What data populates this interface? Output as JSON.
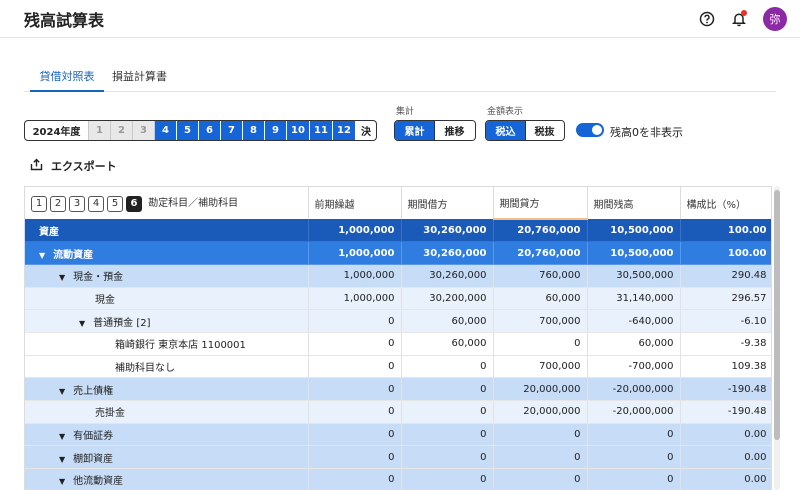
{
  "header": {
    "title": "残高試算表",
    "icons": [
      "help-icon",
      "bell-icon"
    ],
    "avatar_text": "弥"
  },
  "tabs": [
    {
      "label": "貸借対照表",
      "active": true
    },
    {
      "label": "損益計算書",
      "active": false
    }
  ],
  "period": {
    "year": "2024年度",
    "disabled_months": [
      "1",
      "2",
      "3"
    ],
    "active_months": [
      "4",
      "5",
      "6",
      "7",
      "8",
      "9",
      "10",
      "11",
      "12"
    ],
    "closing": "決"
  },
  "aggregation": {
    "label": "集計",
    "options": [
      "累計",
      "推移"
    ],
    "selected": "累計"
  },
  "amount_display": {
    "label": "金額表示",
    "options": [
      "税込",
      "税抜"
    ],
    "selected": "税込"
  },
  "hide_zero": {
    "label": "残高0を非表示",
    "on": true
  },
  "export_label": "エクスポート",
  "table": {
    "level_buttons": [
      "1",
      "2",
      "3",
      "4",
      "5",
      "6"
    ],
    "active_level": "6",
    "account_header": "勘定科目／補助科目",
    "columns": [
      "前期繰越",
      "期間借方",
      "期間貸方",
      "期間残高",
      "構成比（%）"
    ],
    "rows": [
      {
        "name": "資産",
        "level": 0,
        "caret": false,
        "values": [
          "1,000,000",
          "30,260,000",
          "20,760,000",
          "10,500,000",
          "100.00"
        ]
      },
      {
        "name": "流動資産",
        "level": 1,
        "caret": true,
        "values": [
          "1,000,000",
          "30,260,000",
          "20,760,000",
          "10,500,000",
          "100.00"
        ]
      },
      {
        "name": "現金・預金",
        "level": 2,
        "caret": true,
        "values": [
          "1,000,000",
          "30,260,000",
          "760,000",
          "30,500,000",
          "290.48"
        ]
      },
      {
        "name": "現金",
        "level": 3,
        "caret": false,
        "values": [
          "1,000,000",
          "30,200,000",
          "60,000",
          "31,140,000",
          "296.57"
        ]
      },
      {
        "name": "普通預金 [2]",
        "level": 3,
        "caret": true,
        "values": [
          "0",
          "60,000",
          "700,000",
          "-640,000",
          "-6.10"
        ]
      },
      {
        "name": "箱崎銀行 東京本店 1100001",
        "level": 4,
        "caret": false,
        "values": [
          "0",
          "60,000",
          "0",
          "60,000",
          "-9.38"
        ]
      },
      {
        "name": "補助科目なし",
        "level": 4,
        "caret": false,
        "values": [
          "0",
          "0",
          "700,000",
          "-700,000",
          "109.38"
        ]
      },
      {
        "name": "売上債権",
        "level": 2,
        "caret": true,
        "values": [
          "0",
          "0",
          "20,000,000",
          "-20,000,000",
          "-190.48"
        ]
      },
      {
        "name": "売掛金",
        "level": 3,
        "caret": false,
        "values": [
          "0",
          "0",
          "20,000,000",
          "-20,000,000",
          "-190.48"
        ]
      },
      {
        "name": "有価証券",
        "level": 2,
        "caret": true,
        "values": [
          "0",
          "0",
          "0",
          "0",
          "0.00"
        ]
      },
      {
        "name": "棚卸資産",
        "level": 2,
        "caret": true,
        "values": [
          "0",
          "0",
          "0",
          "0",
          "0.00"
        ]
      },
      {
        "name": "他流動資産",
        "level": 2,
        "caret": true,
        "values": [
          "0",
          "0",
          "0",
          "0",
          "0.00"
        ]
      }
    ]
  },
  "colors": {
    "accent": "#1565d8",
    "row_l0": "#1a5ab8",
    "row_l1": "#2f7de0",
    "row_l2": "#c7dcf7",
    "row_l3": "#e9f2fc",
    "avatar": "#8c2aa5"
  }
}
